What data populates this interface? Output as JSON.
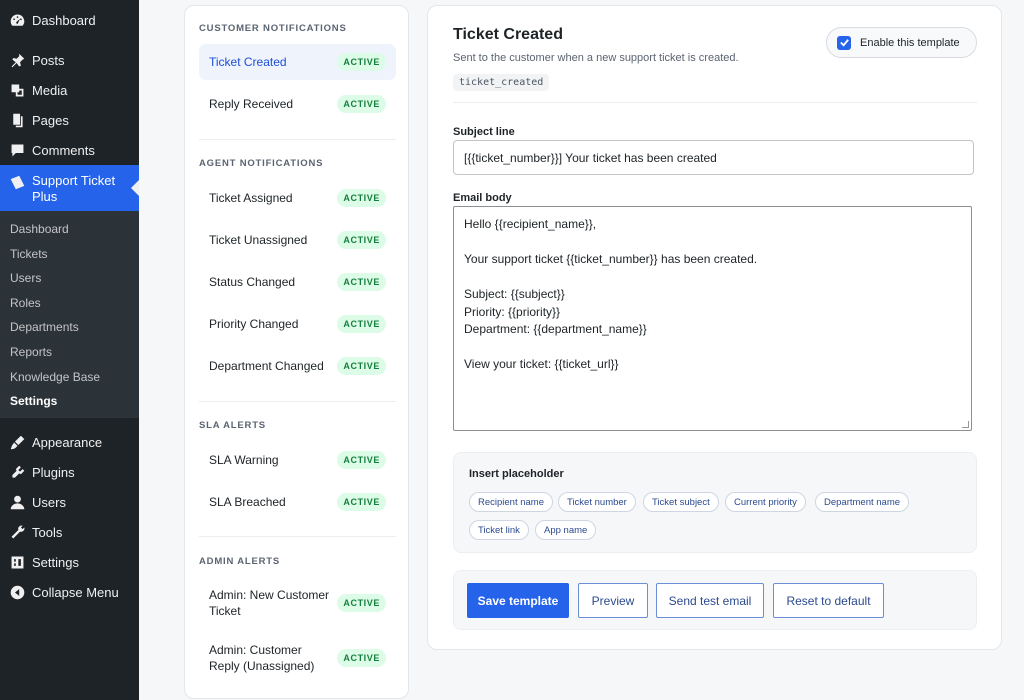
{
  "wp_menu": {
    "top_items": [
      {
        "label": "Dashboard",
        "icon": "dashboard-icon"
      },
      {
        "label": "Posts",
        "icon": "pin-icon"
      },
      {
        "label": "Media",
        "icon": "media-icon"
      },
      {
        "label": "Pages",
        "icon": "pages-icon"
      },
      {
        "label": "Comments",
        "icon": "comments-icon"
      }
    ],
    "current": {
      "label": "Support Ticket Plus",
      "icon": "ticket-icon"
    },
    "submenu": [
      "Dashboard",
      "Tickets",
      "Users",
      "Roles",
      "Departments",
      "Reports",
      "Knowledge Base",
      "Settings"
    ],
    "bottom_items": [
      {
        "label": "Appearance",
        "icon": "brush-icon"
      },
      {
        "label": "Plugins",
        "icon": "plugin-icon"
      },
      {
        "label": "Users",
        "icon": "users-icon"
      },
      {
        "label": "Tools",
        "icon": "wrench-icon"
      },
      {
        "label": "Settings",
        "icon": "settings-icon"
      },
      {
        "label": "Collapse Menu",
        "icon": "collapse-icon"
      }
    ]
  },
  "template_list": {
    "groups": [
      {
        "title": "Customer Notifications",
        "items": [
          {
            "label": "Ticket Created",
            "badge": "ACTIVE",
            "selected": true
          },
          {
            "label": "Reply Received",
            "badge": "ACTIVE"
          }
        ]
      },
      {
        "title": "Agent Notifications",
        "items": [
          {
            "label": "Ticket Assigned",
            "badge": "ACTIVE"
          },
          {
            "label": "Ticket Unassigned",
            "badge": "ACTIVE"
          },
          {
            "label": "Status Changed",
            "badge": "ACTIVE"
          },
          {
            "label": "Priority Changed",
            "badge": "ACTIVE"
          },
          {
            "label": "Department Changed",
            "badge": "ACTIVE"
          }
        ]
      },
      {
        "title": "SLA Alerts",
        "items": [
          {
            "label": "SLA Warning",
            "badge": "ACTIVE"
          },
          {
            "label": "SLA Breached",
            "badge": "ACTIVE"
          }
        ]
      },
      {
        "title": "Admin Alerts",
        "items": [
          {
            "label": "Admin: New Customer Ticket",
            "badge": "ACTIVE"
          },
          {
            "label": "Admin: Customer Reply (Unassigned)",
            "badge": "ACTIVE"
          }
        ]
      }
    ]
  },
  "editor": {
    "title": "Ticket Created",
    "description": "Sent to the customer when a new support ticket is created.",
    "code": "ticket_created",
    "enable_label": "Enable this template",
    "enabled": true,
    "subject_label": "Subject line",
    "subject_value": "[{{ticket_number}}] Your ticket has been created",
    "body_label": "Email body",
    "body_lines": [
      "Hello {{recipient_name}},",
      "",
      "Your support ticket {{ticket_number}} has been created.",
      "",
      "Subject: {{subject}}",
      "Priority: {{priority}}",
      "Department: {{department_name}}",
      "",
      "View your ticket: {{ticket_url}}"
    ],
    "placeholder_title": "Insert placeholder",
    "placeholders": [
      "Recipient name",
      "Ticket number",
      "Ticket subject",
      "Current priority",
      "Department name",
      "Ticket link",
      "App name"
    ],
    "buttons": {
      "save": "Save template",
      "preview": "Preview",
      "send_test": "Send test email",
      "reset": "Reset to default"
    }
  },
  "colors": {
    "accent": "#2563eb",
    "sidebar_bg": "#1d2327",
    "badge_bg": "#dcfce7",
    "badge_text": "#15803d"
  }
}
